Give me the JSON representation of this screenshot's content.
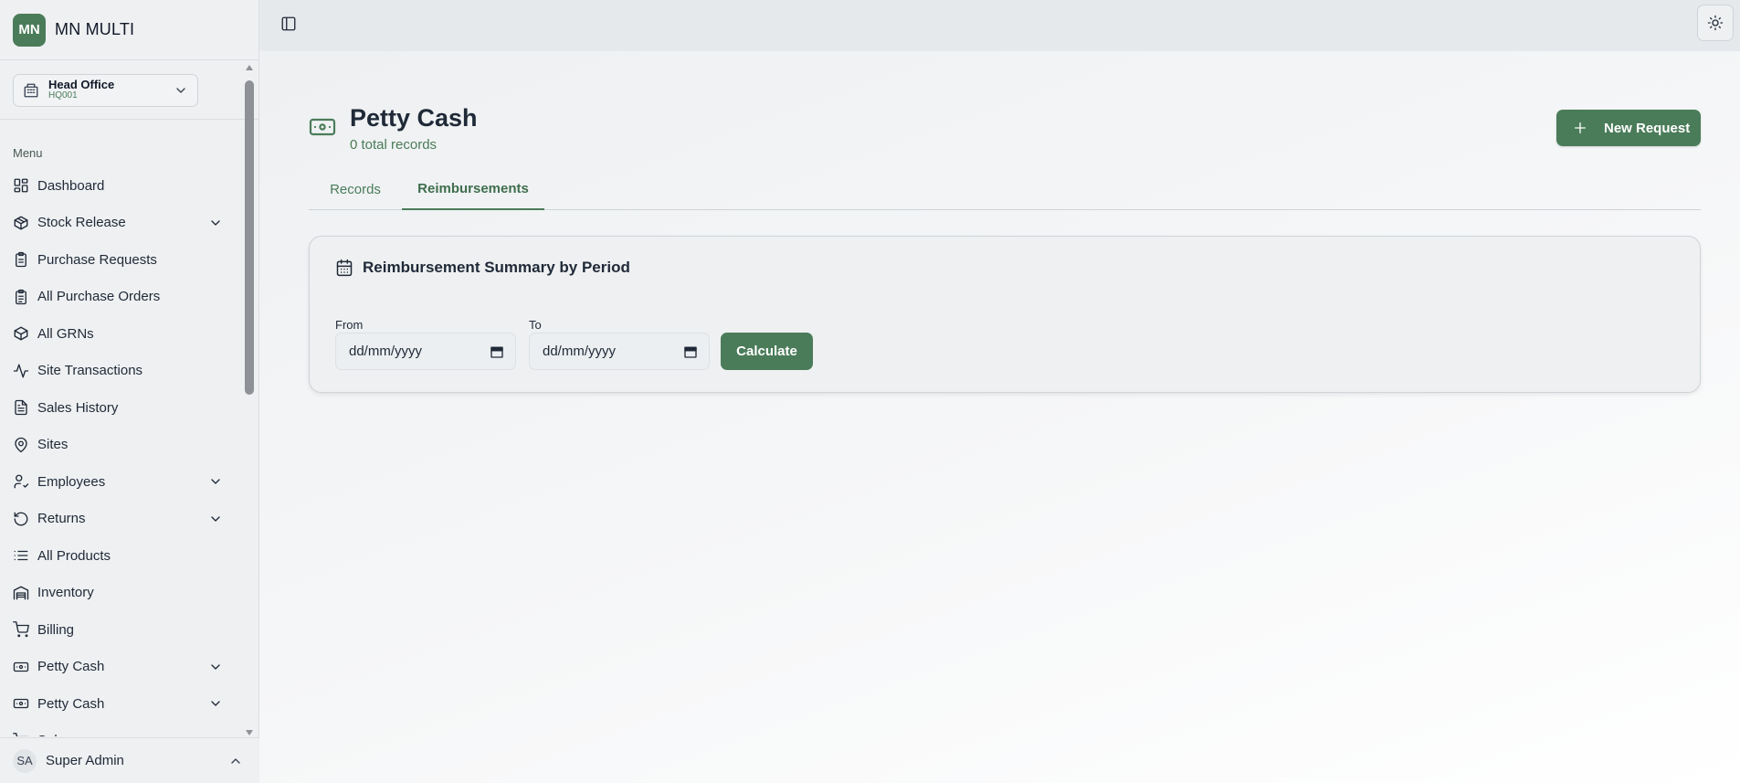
{
  "brand": {
    "logo_text": "MN",
    "name": "MN MULTI",
    "color": "#4a7c59"
  },
  "branch": {
    "name": "Head Office",
    "code": "HQ001"
  },
  "menu": {
    "heading": "Menu",
    "items": [
      {
        "label": "Dashboard",
        "icon": "dashboard-icon",
        "expandable": false
      },
      {
        "label": "Stock Release",
        "icon": "package-icon",
        "expandable": true
      },
      {
        "label": "Purchase Requests",
        "icon": "clipboard-icon",
        "expandable": false
      },
      {
        "label": "All Purchase Orders",
        "icon": "clipboard-list-icon",
        "expandable": false
      },
      {
        "label": "All GRNs",
        "icon": "box-icon",
        "expandable": false
      },
      {
        "label": "Site Transactions",
        "icon": "activity-icon",
        "expandable": false
      },
      {
        "label": "Sales History",
        "icon": "file-text-icon",
        "expandable": false
      },
      {
        "label": "Sites",
        "icon": "map-pin-icon",
        "expandable": false
      },
      {
        "label": "Employees",
        "icon": "user-check-icon",
        "expandable": true
      },
      {
        "label": "Returns",
        "icon": "rotate-ccw-icon",
        "expandable": true
      },
      {
        "label": "All Products",
        "icon": "list-icon",
        "expandable": false
      },
      {
        "label": "Inventory",
        "icon": "warehouse-icon",
        "expandable": false
      },
      {
        "label": "Billing",
        "icon": "cart-icon",
        "expandable": false
      },
      {
        "label": "Petty Cash",
        "icon": "banknote-icon",
        "expandable": true
      },
      {
        "label": "Petty Cash",
        "icon": "banknote-icon",
        "expandable": true
      },
      {
        "label": "Sales",
        "icon": "cart-icon",
        "expandable": false
      }
    ]
  },
  "user": {
    "initials": "SA",
    "name": "Super Admin"
  },
  "page": {
    "title": "Petty Cash",
    "subtitle": "0 total records",
    "new_button": "New Request"
  },
  "tabs": [
    {
      "label": "Records",
      "active": false
    },
    {
      "label": "Reimbursements",
      "active": true
    }
  ],
  "summary": {
    "title": "Reimbursement Summary by Period",
    "from_label": "From",
    "to_label": "To",
    "from_value": "dd/mm/yyyy",
    "to_value": "dd/mm/yyyy",
    "calculate_label": "Calculate"
  }
}
